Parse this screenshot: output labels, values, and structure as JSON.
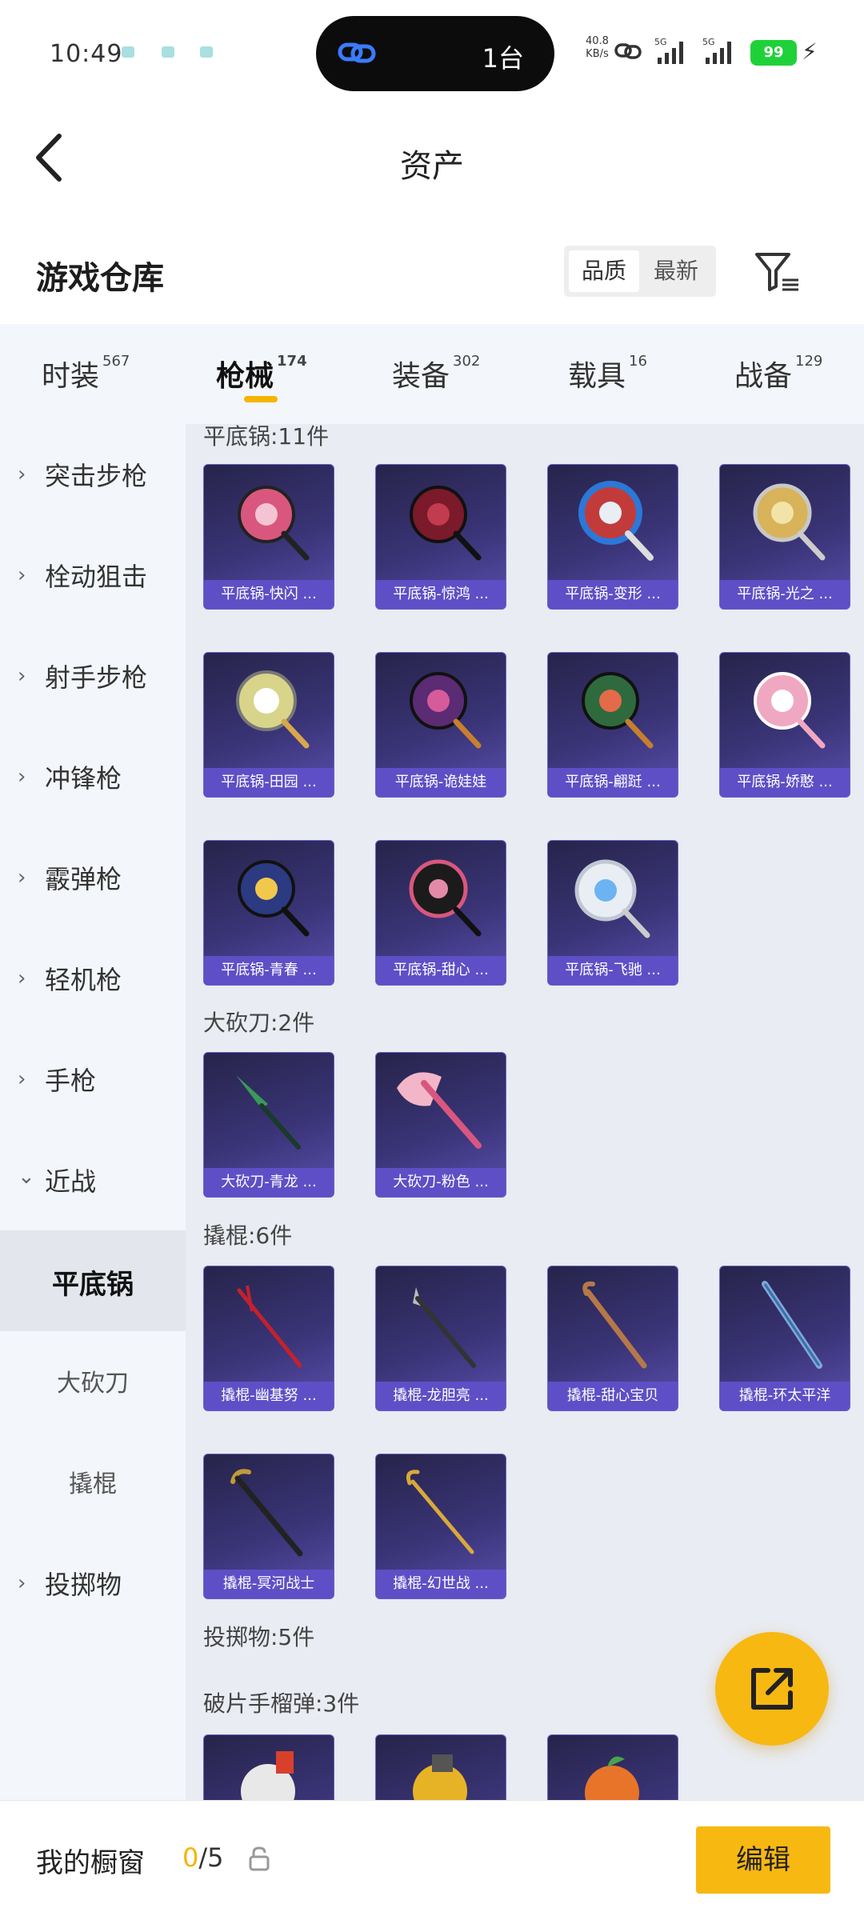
{
  "status_bar": {
    "time": "10:49",
    "island_count": "1台",
    "net_speed": "40.8",
    "net_unit": "KB/s",
    "sig1": "5G",
    "sig2": "5G",
    "battery": "99"
  },
  "header": {
    "title": "资产",
    "back_icon": "chevron-left-icon"
  },
  "section": {
    "title": "游戏仓库",
    "sort_options": [
      "品质",
      "最新"
    ],
    "active_sort": "品质",
    "filter_icon": "filter-icon"
  },
  "tabs": [
    {
      "label": "时装",
      "count": "567"
    },
    {
      "label": "枪械",
      "count": "174",
      "active": true
    },
    {
      "label": "装备",
      "count": "302"
    },
    {
      "label": "载具",
      "count": "16"
    },
    {
      "label": "战备",
      "count": "129"
    }
  ],
  "sidebar": [
    {
      "label": "突击步枪",
      "type": "category"
    },
    {
      "label": "栓动狙击",
      "type": "category"
    },
    {
      "label": "射手步枪",
      "type": "category"
    },
    {
      "label": "冲锋枪",
      "type": "category"
    },
    {
      "label": "霰弹枪",
      "type": "category"
    },
    {
      "label": "轻机枪",
      "type": "category"
    },
    {
      "label": "手枪",
      "type": "category"
    },
    {
      "label": "近战",
      "type": "category-open"
    },
    {
      "label": "平底锅",
      "type": "sub-active"
    },
    {
      "label": "大砍刀",
      "type": "sub"
    },
    {
      "label": "撬棍",
      "type": "sub"
    },
    {
      "label": "投掷物",
      "type": "category"
    }
  ],
  "groups": [
    {
      "title": "平底锅:11件",
      "items": [
        "平底锅-快闪 ...",
        "平底锅-惊鸿 ...",
        "平底锅-变形 ...",
        "平底锅-光之 ...",
        "平底锅-田园 ...",
        "平底锅-诡娃娃",
        "平底锅-翩跹 ...",
        "平底锅-娇憨 ...",
        "平底锅-青春 ...",
        "平底锅-甜心 ...",
        "平底锅-飞驰 ..."
      ]
    },
    {
      "title": "大砍刀:2件",
      "items": [
        "大砍刀-青龙 ...",
        "大砍刀-粉色 ..."
      ]
    },
    {
      "title": "撬棍:6件",
      "items": [
        "撬棍-幽基努 ...",
        "撬棍-龙胆亮 ...",
        "撬棍-甜心宝贝",
        "撬棍-环太平洋",
        "撬棍-冥河战士",
        "撬棍-幻世战 ..."
      ]
    },
    {
      "title": "投掷物:5件",
      "items": []
    },
    {
      "title": "破片手榴弹:3件",
      "items": [
        "",
        "",
        ""
      ]
    }
  ],
  "fab_icon": "share-external-icon",
  "bottom_bar": {
    "label": "我的橱窗",
    "current": "0",
    "total": "/5",
    "lock_icon": "lock-icon",
    "edit_label": "编辑"
  }
}
